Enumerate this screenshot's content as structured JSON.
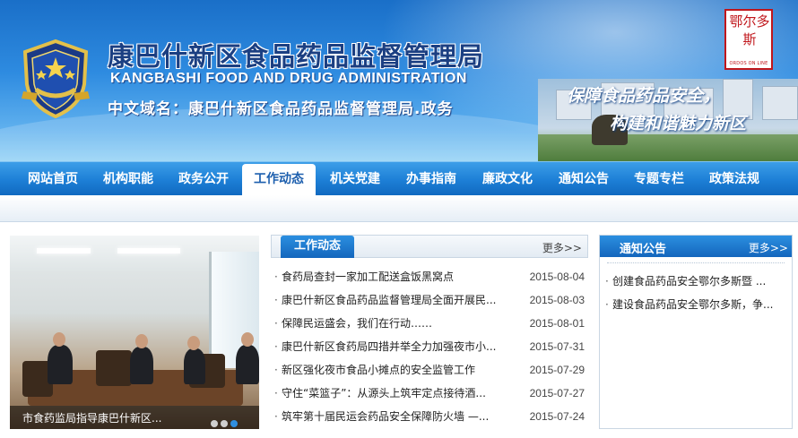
{
  "header": {
    "title_cn": "康巴什新区食品药品监督管理局",
    "title_en": "KANGBASHI FOOD AND DRUG ADMINISTRATION",
    "domain_line": "中文域名：康巴什新区食品药品监督管理局.政务",
    "slogan_line1": "保障食品药品安全，",
    "slogan_line2": "构建和谐魅力新区",
    "seal_text": "鄂尔多斯",
    "seal_en": "ORDOS ON LINE",
    "emblem_icon": "food-drug-emblem-icon"
  },
  "nav": {
    "items": [
      {
        "label": "网站首页"
      },
      {
        "label": "机构职能"
      },
      {
        "label": "政务公开"
      },
      {
        "label": "工作动态"
      },
      {
        "label": "机关党建"
      },
      {
        "label": "办事指南"
      },
      {
        "label": "廉政文化"
      },
      {
        "label": "通知公告"
      },
      {
        "label": "专题专栏"
      },
      {
        "label": "政策法规"
      }
    ],
    "active_label": "工作动态"
  },
  "slideshow": {
    "caption": "市食药监局指导康巴什新区...",
    "dot_count": 3,
    "active_dot": 3
  },
  "work_news": {
    "title": "工作动态",
    "more_label": "更多>>",
    "items": [
      {
        "title": "食药局查封一家加工配送盒饭黑窝点",
        "date": "2015-08-04"
      },
      {
        "title": "康巴什新区食品药品监督管理局全面开展民...",
        "date": "2015-08-03"
      },
      {
        "title": "保障民运盛会，我们在行动……",
        "date": "2015-08-01"
      },
      {
        "title": "康巴什新区食药局四措并举全力加强夜市小...",
        "date": "2015-07-31"
      },
      {
        "title": "新区强化夜市食品小摊点的安全监管工作",
        "date": "2015-07-29"
      },
      {
        "title": "守住“菜篮子”：从源头上筑牢定点接待酒...",
        "date": "2015-07-27"
      },
      {
        "title": "筑牢第十届民运会药品安全保障防火墙 —...",
        "date": "2015-07-24"
      }
    ]
  },
  "notices": {
    "title": "通知公告",
    "more_label": "更多>>",
    "items": [
      {
        "title": "创建食品药品安全鄂尔多斯暨 ..."
      },
      {
        "title": "建设食品药品安全鄂尔多斯，争..."
      }
    ]
  },
  "colors": {
    "nav_blue": "#1d7fd6",
    "title_blue": "#1b3f82",
    "seal_red": "#c0161b"
  }
}
